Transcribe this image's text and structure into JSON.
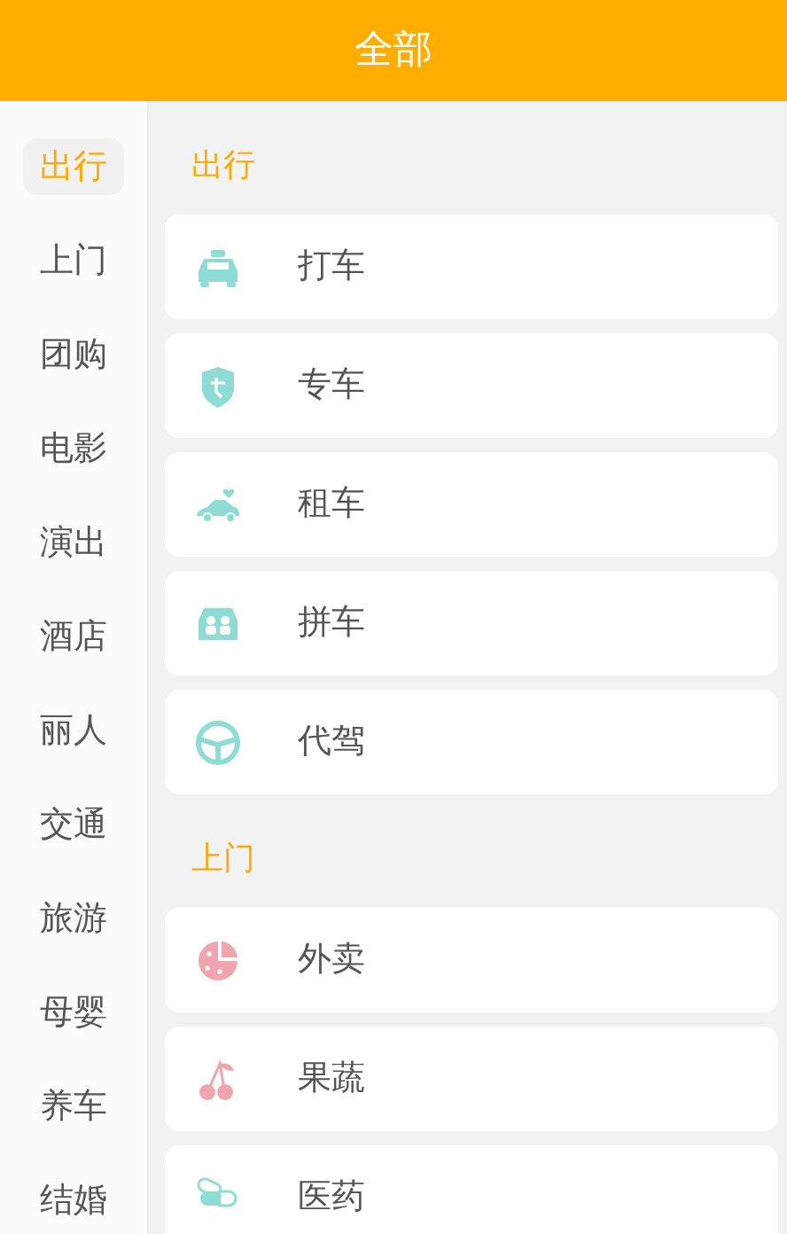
{
  "header": {
    "title": "全部"
  },
  "sidebar": {
    "items": [
      {
        "label": "出行",
        "selected": true
      },
      {
        "label": "上门",
        "selected": false
      },
      {
        "label": "团购",
        "selected": false
      },
      {
        "label": "电影",
        "selected": false
      },
      {
        "label": "演出",
        "selected": false
      },
      {
        "label": "酒店",
        "selected": false
      },
      {
        "label": "丽人",
        "selected": false
      },
      {
        "label": "交通",
        "selected": false
      },
      {
        "label": "旅游",
        "selected": false
      },
      {
        "label": "母婴",
        "selected": false
      },
      {
        "label": "养车",
        "selected": false
      },
      {
        "label": "结婚",
        "selected": false
      }
    ]
  },
  "sections": [
    {
      "title": "出行",
      "items": [
        {
          "label": "打车"
        },
        {
          "label": "专车"
        },
        {
          "label": "租车"
        },
        {
          "label": "拼车"
        },
        {
          "label": "代驾"
        }
      ]
    },
    {
      "title": "上门",
      "items": [
        {
          "label": "外卖"
        },
        {
          "label": "果蔬"
        },
        {
          "label": "医药"
        }
      ]
    }
  ]
}
